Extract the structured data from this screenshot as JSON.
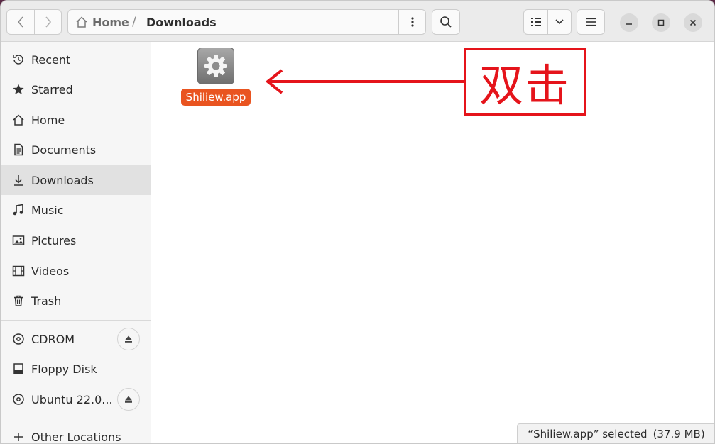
{
  "header": {
    "path": {
      "home": "Home",
      "separator": "/",
      "current": "Downloads"
    }
  },
  "sidebar": {
    "places": [
      {
        "label": "Recent",
        "icon": "clock-icon"
      },
      {
        "label": "Starred",
        "icon": "star-icon"
      },
      {
        "label": "Home",
        "icon": "home-icon"
      },
      {
        "label": "Documents",
        "icon": "document-icon"
      },
      {
        "label": "Downloads",
        "icon": "download-icon",
        "active": true
      },
      {
        "label": "Music",
        "icon": "music-icon"
      },
      {
        "label": "Pictures",
        "icon": "picture-icon"
      },
      {
        "label": "Videos",
        "icon": "video-icon"
      },
      {
        "label": "Trash",
        "icon": "trash-icon"
      }
    ],
    "devices": [
      {
        "label": "CDROM",
        "icon": "disc-icon",
        "eject": true
      },
      {
        "label": "Floppy Disk",
        "icon": "drive-icon",
        "eject": false
      },
      {
        "label": "Ubuntu 22.0...",
        "icon": "disc-icon",
        "eject": true
      }
    ],
    "other_locations": "Other Locations"
  },
  "content": {
    "files": [
      {
        "name": "Shiliew.app",
        "icon": "gear-icon",
        "selected": true
      }
    ],
    "annotation": {
      "text": "双击"
    }
  },
  "status": {
    "selection": "“Shiliew.app” selected",
    "size": "(37.9 MB)"
  },
  "colors": {
    "accent": "#e95420",
    "annotation": "#e5141b"
  }
}
